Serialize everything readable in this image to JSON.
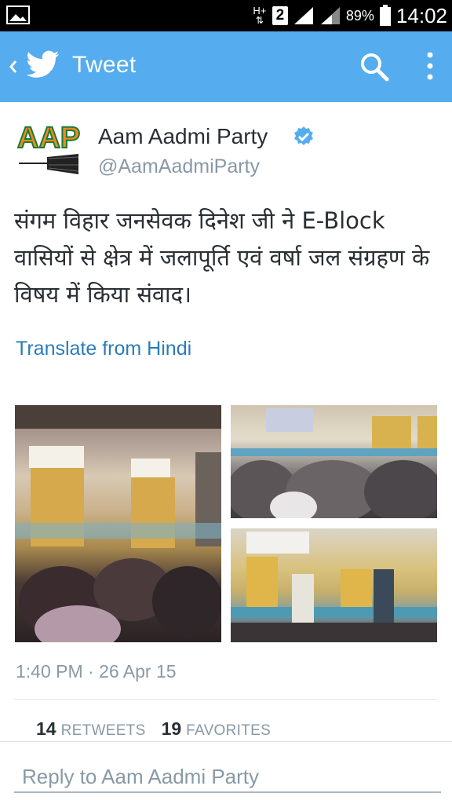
{
  "status_bar": {
    "network": "H+",
    "sim": "2",
    "battery_percent": "89%",
    "time": "14:02",
    "icons": [
      "gallery-icon",
      "signal-icon",
      "signal-icon",
      "battery-icon"
    ]
  },
  "app_bar": {
    "title": "Tweet",
    "icons": [
      "back-icon",
      "twitter-bird-icon",
      "search-icon",
      "more-icon"
    ],
    "background": "#55acee"
  },
  "tweet": {
    "author_name": "Aam Aadmi Party",
    "handle": "@AamAadmiParty",
    "verified": true,
    "logo_text": "AAP",
    "text": "संगम विहार जनसेवक दिनेश जी ने E-Block वासियों से क्षेत्र में जलापूर्ति एवं वर्षा जल संग्रहण के विषय में किया संवाद।",
    "translate_label": "Translate from Hindi",
    "timestamp": "1:40 PM · 26 Apr 15",
    "retweets_count": "14",
    "retweets_label": "RETWEETS",
    "favorites_count": "19",
    "favorites_label": "FAVORITES"
  },
  "reply": {
    "placeholder": "Reply to Aam Aadmi Party"
  },
  "colors": {
    "link": "#2b7bb9",
    "secondary_text": "#8899a6",
    "primary_text": "#292f33",
    "verified": "#55acee"
  }
}
